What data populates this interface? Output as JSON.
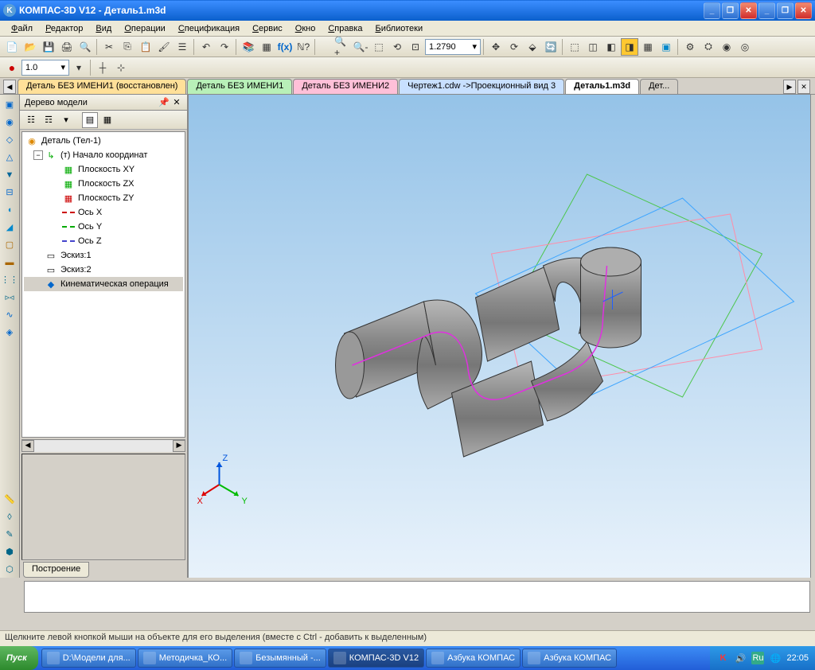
{
  "title": "КОМПАС-3D V12 - Деталь1.m3d",
  "menu": [
    "Файл",
    "Редактор",
    "Вид",
    "Операции",
    "Спецификация",
    "Сервис",
    "Окно",
    "Справка",
    "Библиотеки"
  ],
  "toolbar2_value": "1.0",
  "zoom_value": "1.2790",
  "doctabs": [
    {
      "label": "Деталь БЕЗ ИМЕНИ1 (восстановлен)",
      "cls": "orange"
    },
    {
      "label": "Деталь БЕЗ ИМЕНИ1",
      "cls": "green"
    },
    {
      "label": "Деталь БЕЗ ИМЕНИ2",
      "cls": "pink"
    },
    {
      "label": "Чертеж1.cdw ->Проекционный вид 3",
      "cls": "blue"
    },
    {
      "label": "Деталь1.m3d",
      "cls": "active"
    },
    {
      "label": "Дет...",
      "cls": ""
    }
  ],
  "tree_title": "Дерево модели",
  "tree": {
    "root": "Деталь (Тел-1)",
    "origin": "(т) Начало координат",
    "planes": [
      "Плоскость XY",
      "Плоскость ZX",
      "Плоскость ZY"
    ],
    "axes": [
      "Ось X",
      "Ось Y",
      "Ось Z"
    ],
    "sketches": [
      "Эскиз:1",
      "Эскиз:2"
    ],
    "op": "Кинематическая операция"
  },
  "panel_tab": "Построение",
  "axis_labels": {
    "x": "X",
    "y": "Y",
    "z": "Z"
  },
  "status": "Щелкните левой кнопкой мыши на объекте для его выделения (вместе с Ctrl - добавить к выделенным)",
  "taskbar": {
    "start": "Пуск",
    "tasks": [
      "D:\\Модели для...",
      "Методичка_КО...",
      "Безымянный -...",
      "КОМПАС-3D V12",
      "Азбука КОМПАС",
      "Азбука КОМПАС"
    ],
    "active_idx": 3,
    "lang": "Ru",
    "time": "22:05"
  }
}
